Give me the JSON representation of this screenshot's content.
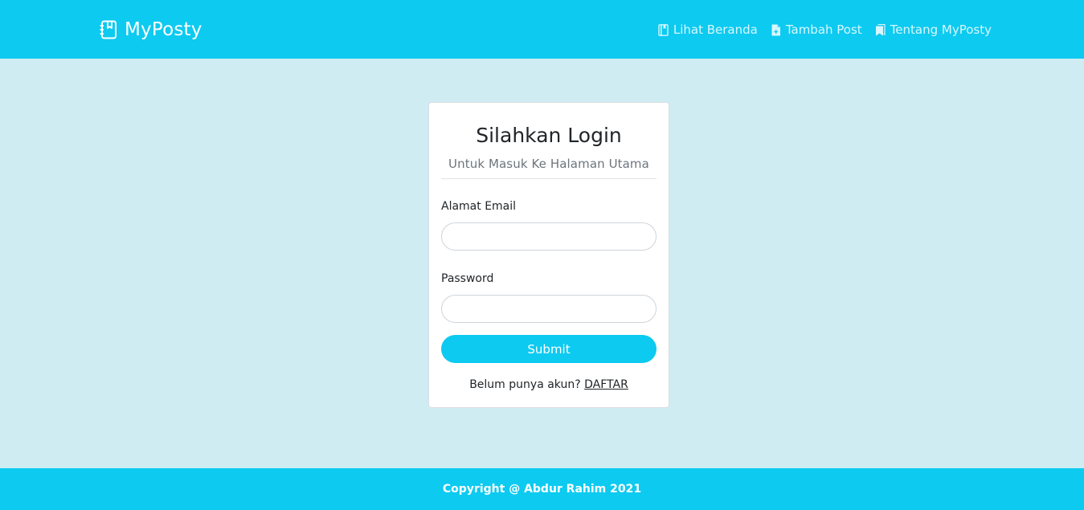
{
  "navbar": {
    "brand": "MyPosty",
    "brand_icon": "notebook-icon",
    "links": [
      {
        "label": "Lihat Beranda",
        "icon": "book-icon"
      },
      {
        "label": "Tambah Post",
        "icon": "file-plus-icon"
      },
      {
        "label": "Tentang MyPosty",
        "icon": "bookmarks-icon"
      }
    ]
  },
  "login": {
    "title": "Silahkan Login",
    "subtitle": "Untuk Masuk Ke Halaman Utama",
    "email_label": "Alamat Email",
    "email_value": "",
    "password_label": "Password",
    "password_value": "",
    "submit_label": "Submit",
    "register_prompt": "Belum punya akun?",
    "register_link": "DAFTAR"
  },
  "footer": {
    "text": "Copyright @ Abdur Rahim 2021"
  },
  "colors": {
    "primary": "#0dcaf0",
    "background": "#ceecf2"
  }
}
